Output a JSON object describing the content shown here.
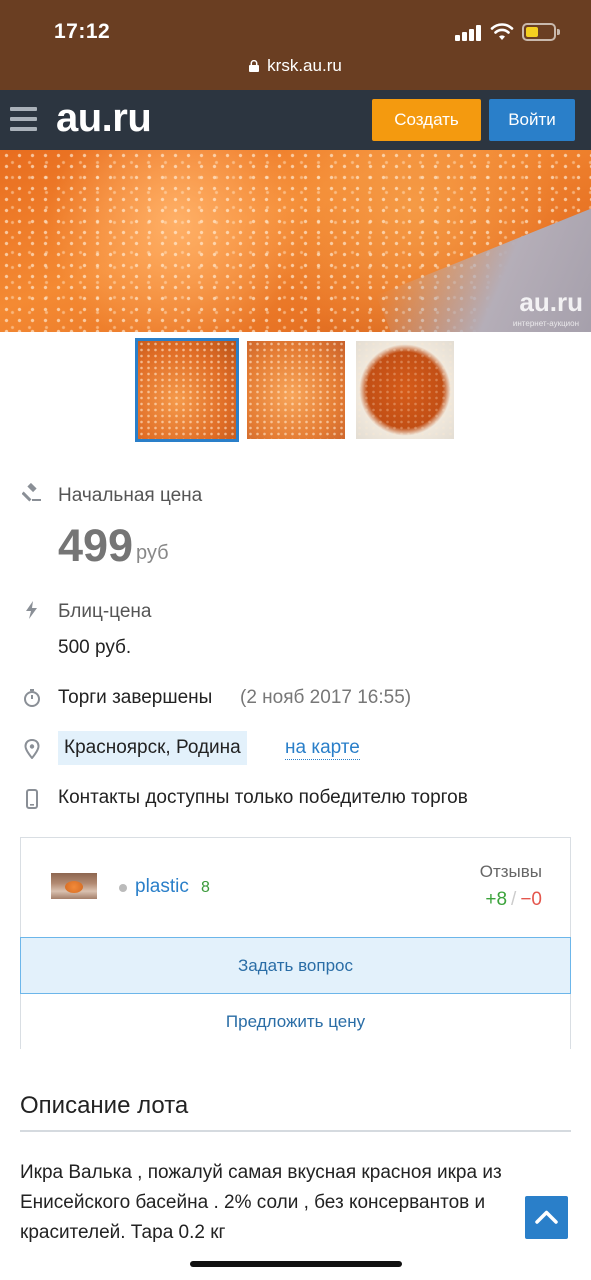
{
  "status_bar": {
    "time": "17:12",
    "url": "krsk.au.ru"
  },
  "header": {
    "logo": "au.ru",
    "create_label": "Создать",
    "login_label": "Войти"
  },
  "photo": {
    "watermark": "au.ru",
    "watermark_sub": "интернет-аукцион"
  },
  "lot": {
    "start_price_label": "Начальная цена",
    "start_price_value": "499",
    "start_price_unit": "руб",
    "blitz_label": "Блиц-цена",
    "blitz_value": "500 руб.",
    "auction_status": "Торги завершены",
    "auction_date": "(2 нояб 2017 16:55)",
    "location": "Красноярск, Родина",
    "map_link": "на карте",
    "contacts_note": "Контакты доступны только победителю торгов"
  },
  "seller": {
    "name": "plastic",
    "rating": "8",
    "reviews_label": "Отзывы",
    "reviews_positive": "+8",
    "reviews_separator": "/",
    "reviews_negative": "−0",
    "ask_question_label": "Задать вопрос",
    "offer_price_label": "Предложить цену"
  },
  "description": {
    "title": "Описание лота",
    "text": "Икра Валька , пожалуй самая вкусная красноя икра из Енисейского басейна . 2% соли , без консервантов и красителей. Тара 0.2 кг"
  },
  "colors": {
    "accent": "#2a7fc9",
    "create_button": "#f49a0f",
    "header_bg": "#2c3540",
    "status_bg": "#6a3e22"
  }
}
